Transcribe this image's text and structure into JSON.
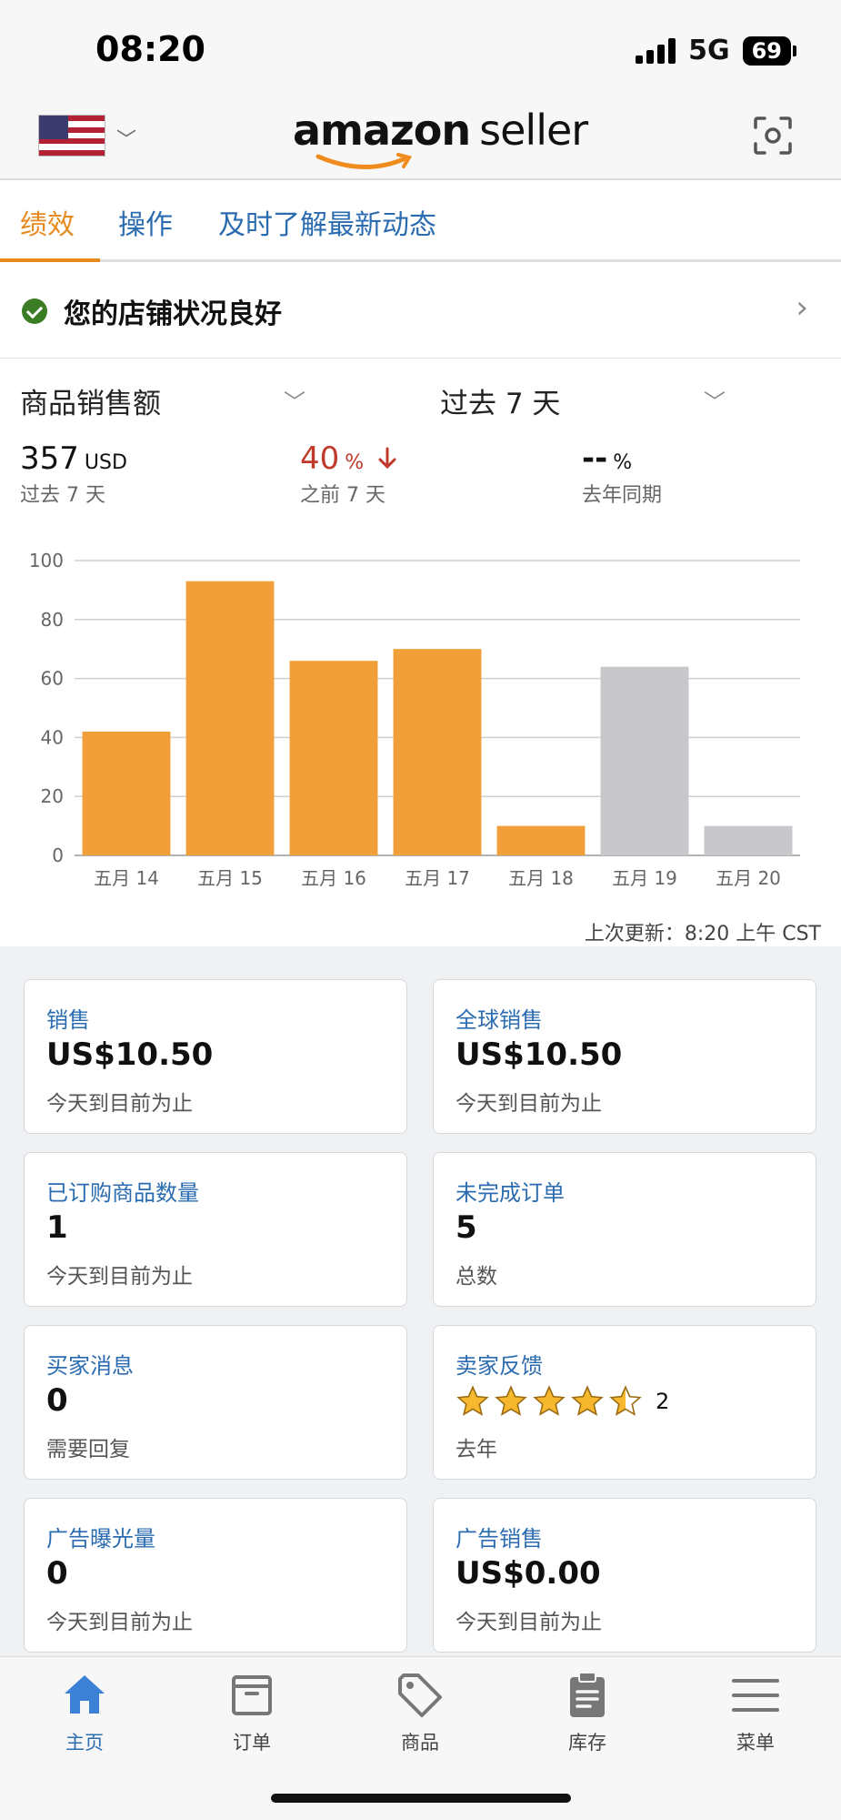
{
  "status_bar": {
    "time": "08:20",
    "network": "5G",
    "battery": "69"
  },
  "header": {
    "logo_main": "amazon",
    "logo_sub": "seller"
  },
  "tabs": [
    {
      "label": "绩效",
      "active": true
    },
    {
      "label": "操作",
      "active": false
    },
    {
      "label": "及时了解最新动态",
      "active": false
    }
  ],
  "store_status": {
    "text": "您的店铺状况良好"
  },
  "selectors": {
    "metric": "商品销售额",
    "period": "过去 7 天"
  },
  "summary": {
    "current_value": "357",
    "current_unit": "USD",
    "current_label": "过去 7 天",
    "change_value": "40",
    "change_unit": "%",
    "change_label": "之前 7 天",
    "yoy_value": "--",
    "yoy_unit": "%",
    "yoy_label": "去年同期"
  },
  "chart_data": {
    "type": "bar",
    "categories": [
      "五月 14",
      "五月 15",
      "五月 16",
      "五月 17",
      "五月 18",
      "五月 19",
      "五月 20"
    ],
    "values": [
      42,
      93,
      66,
      70,
      10,
      64,
      10
    ],
    "highlight": [
      true,
      true,
      true,
      true,
      true,
      false,
      false
    ],
    "colors": {
      "highlight": "#f19f38",
      "muted": "#c8c8cc"
    },
    "ylim": [
      0,
      100
    ],
    "yticks": [
      0,
      20,
      40,
      60,
      80,
      100
    ],
    "grid": true
  },
  "chart_footer": {
    "updated": "上次更新：8:20 上午 CST"
  },
  "cards": [
    {
      "title": "销售",
      "value": "US$10.50",
      "sub": "今天到目前为止"
    },
    {
      "title": "全球销售",
      "value": "US$10.50",
      "sub": "今天到目前为止"
    },
    {
      "title": "已订购商品数量",
      "value": "1",
      "sub": "今天到目前为止"
    },
    {
      "title": "未完成订单",
      "value": "5",
      "sub": "总数"
    },
    {
      "title": "买家消息",
      "value": "0",
      "sub": "需要回复"
    },
    {
      "title": "卖家反馈",
      "rating": 4.5,
      "count": "2",
      "sub": "去年"
    },
    {
      "title": "广告曝光量",
      "value": "0",
      "sub": "今天到目前为止"
    },
    {
      "title": "广告销售",
      "value": "US$0.00",
      "sub": "今天到目前为止"
    }
  ],
  "bottom_nav": [
    {
      "label": "主页",
      "icon": "home-icon",
      "active": true
    },
    {
      "label": "订单",
      "icon": "orders-icon",
      "active": false
    },
    {
      "label": "商品",
      "icon": "tag-icon",
      "active": false
    },
    {
      "label": "库存",
      "icon": "clipboard-icon",
      "active": false
    },
    {
      "label": "菜单",
      "icon": "menu-icon",
      "active": false
    }
  ],
  "colors": {
    "accent": "#e78a1e",
    "link": "#2b6cb0",
    "success": "#3a7d25",
    "alert": "#c0392b"
  }
}
